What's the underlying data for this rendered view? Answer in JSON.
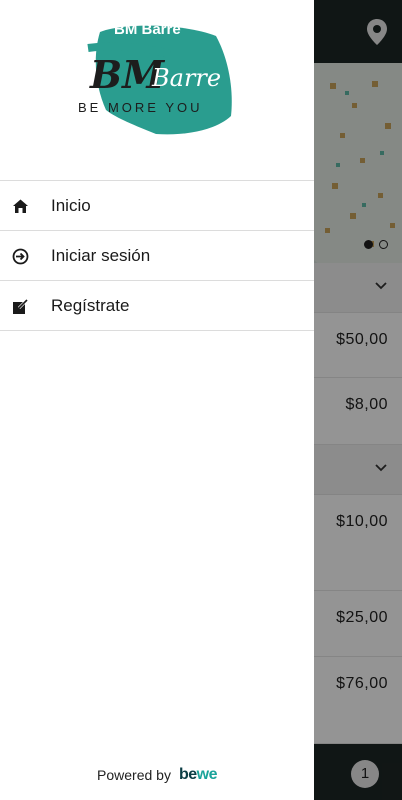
{
  "background": {
    "prices": [
      "$50,00",
      "$8,00",
      "$10,00",
      "$25,00",
      "$76,00"
    ],
    "cart_count": "1",
    "accent_color": "#1d2625"
  },
  "brand": {
    "logo_initials": "BM",
    "logo_script": "Barre",
    "logo_tagline": "BE MORE YOU",
    "logo_top_text": "BM Barre",
    "logo_color": "#2a9d8f"
  },
  "menu": {
    "items": [
      {
        "label": "Inicio",
        "icon": "home-icon"
      },
      {
        "label": "Iniciar sesión",
        "icon": "login-icon"
      },
      {
        "label": "Regístrate",
        "icon": "register-icon"
      }
    ]
  },
  "footer": {
    "powered_by": "Powered by",
    "brand_be": "be",
    "brand_we": "we"
  }
}
